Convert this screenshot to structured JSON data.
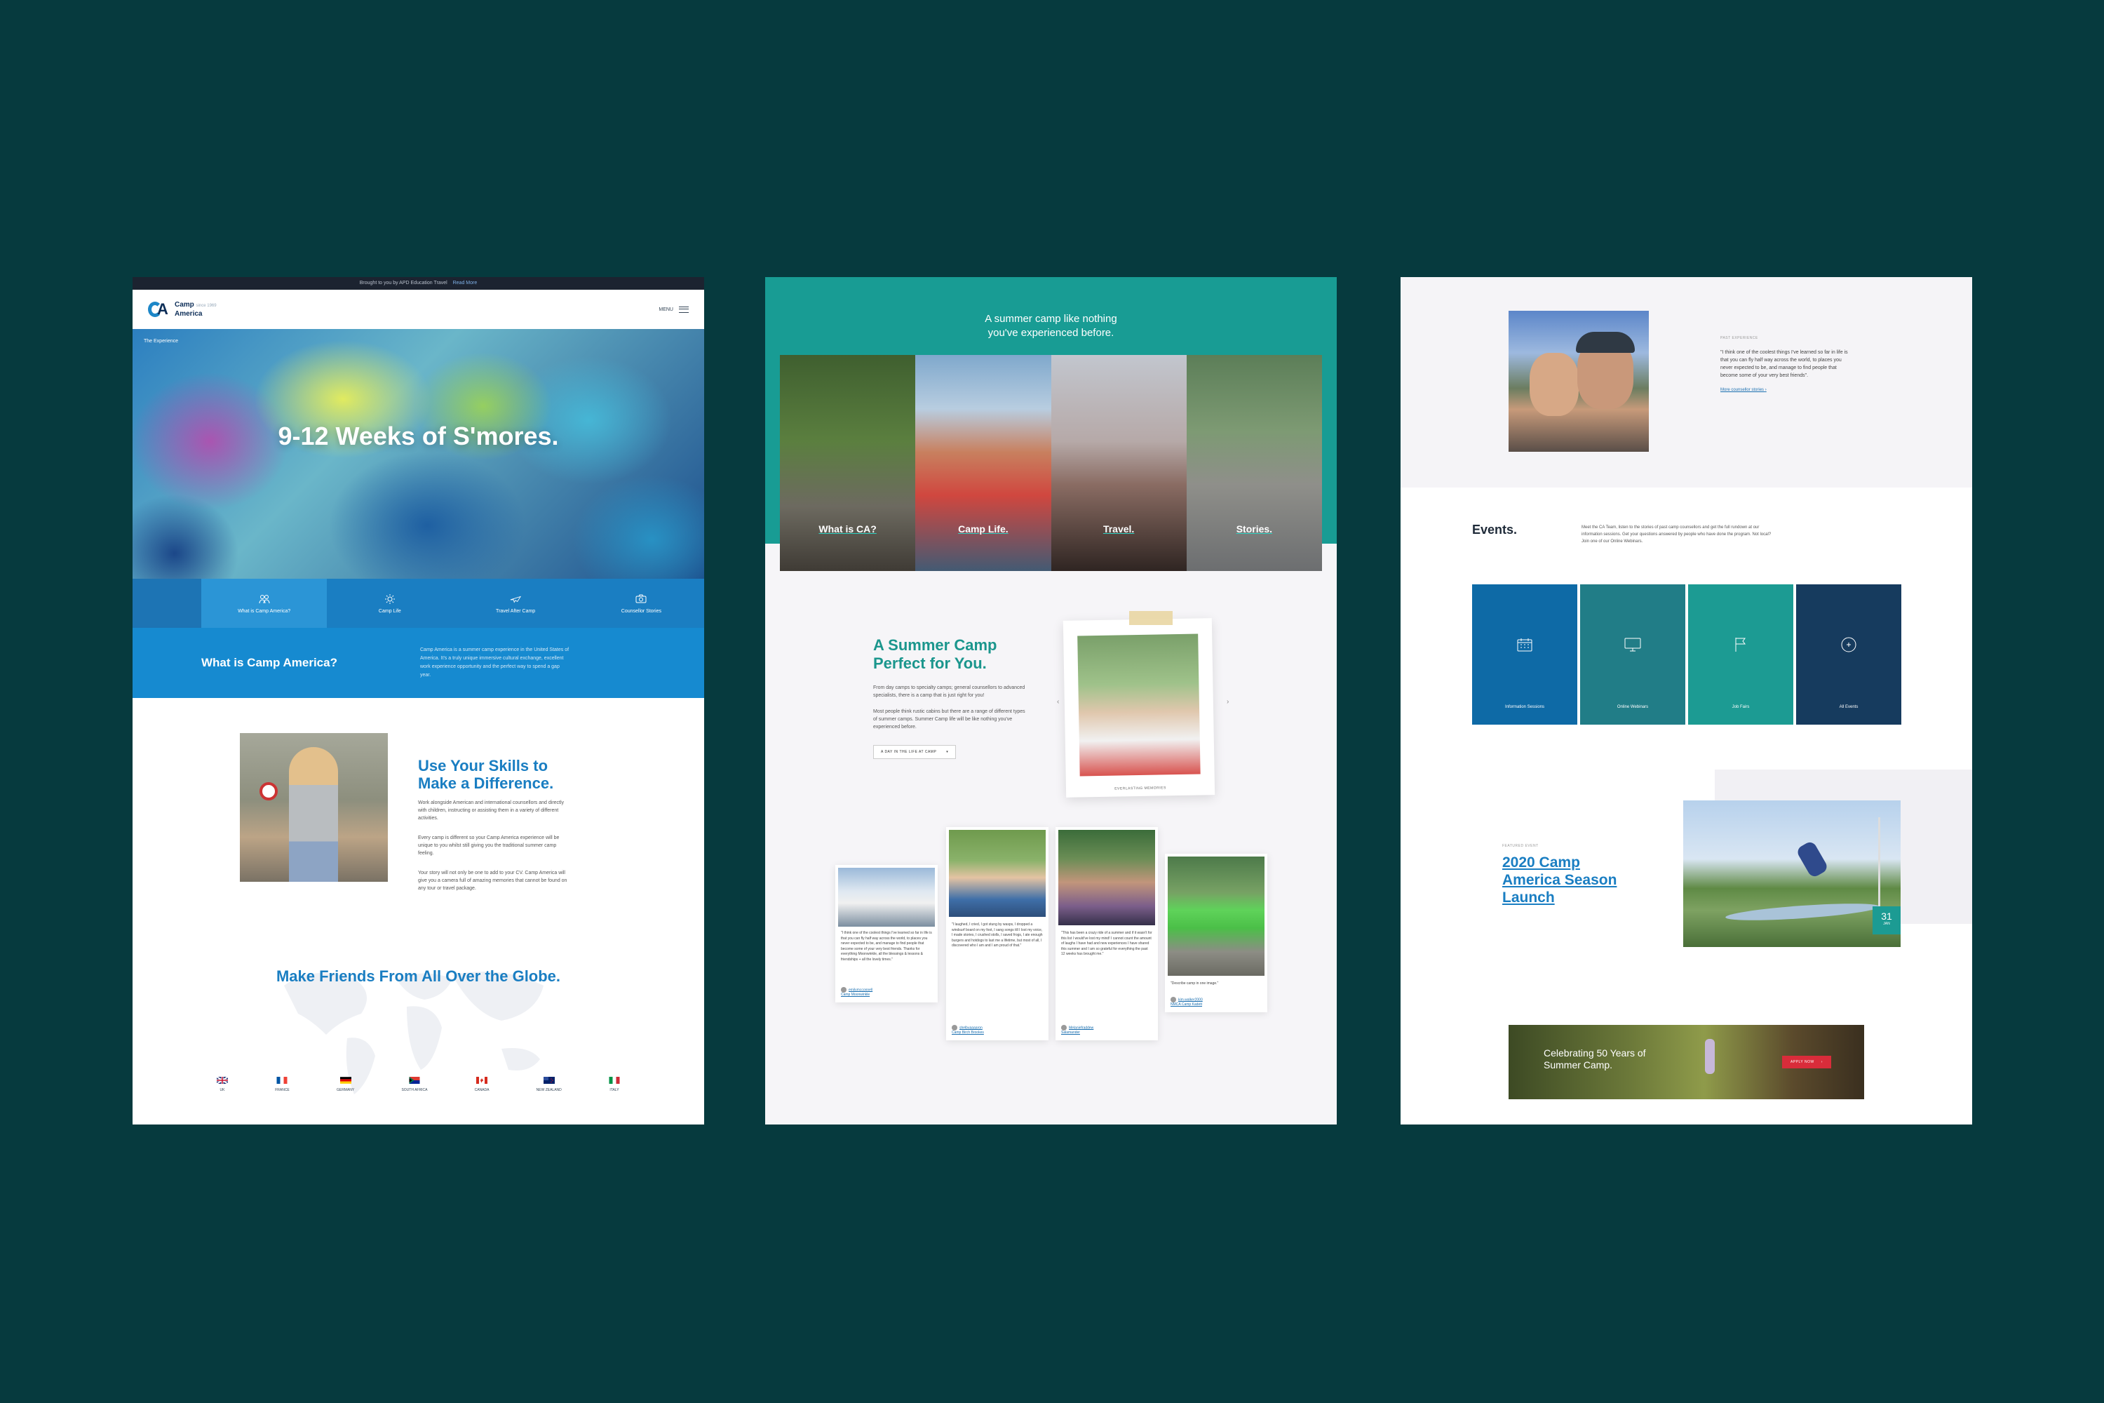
{
  "panel1": {
    "topbar": {
      "text": "Brought to you by APD Education Travel",
      "link": "Read More"
    },
    "logo": {
      "line1": "Camp",
      "line2": "America",
      "small": "since 1969"
    },
    "nav": {
      "menu_label": "MENU"
    },
    "hero": {
      "breadcrumb": "The Experience",
      "title": "9-12 Weeks of S'mores."
    },
    "tabs": [
      {
        "label": "What is Camp America?",
        "icon": "people-icon"
      },
      {
        "label": "Camp Life",
        "icon": "sun-icon"
      },
      {
        "label": "Travel After Camp",
        "icon": "plane-icon"
      },
      {
        "label": "Counsellor Stories",
        "icon": "camera-icon"
      }
    ],
    "what": {
      "title": "What is Camp America?",
      "body": "Camp America is a summer camp experience in the United States of America. It's a truly unique immersive cultural exchange, excellent work experience opportunity and the perfect way to spend a gap year."
    },
    "skills": {
      "title": "Use Your Skills to Make a Difference.",
      "p1": "Work alongside American and international counsellors and directly with children, instructing or assisting them in a variety of different activities.",
      "p2": "Every camp is different so your Camp America experience will be unique to you whilst still giving you the traditional summer camp feeling.",
      "p3": "Your story will not only be one to add to your CV. Camp America will give you a camera full of amazing memories that cannot be found on any tour or travel package."
    },
    "globe": {
      "title": "Make Friends From All Over the Globe.",
      "countries": [
        "UK",
        "FRANCE",
        "GERMANY",
        "SOUTH AFRICA",
        "CANADA",
        "NEW ZEALAND",
        "ITALY"
      ]
    }
  },
  "panel2": {
    "headline": "A summer camp like nothing you've experienced before.",
    "tiles": [
      "What is CA?",
      "Camp Life.",
      "Travel.",
      "Stories."
    ],
    "camp": {
      "title": "A Summer Camp Perfect for You.",
      "p1": "From day camps to specialty camps; general counsellors to advanced specialists, there is a camp that is just right for you!",
      "p2": "Most people think rustic cabins but there are a range of different types of summer camps. Summer Camp life will be like nothing you've experienced before.",
      "button": "A DAY IN THE LIFE AT CAMP"
    },
    "polaroid_caption": "EVERLASTING MEMORIES",
    "cards": [
      {
        "text": "\"I think one of the coolest things I've learned so far in life is that you can fly half way across the world, to places you never expected to be, and manage to find people that become some of your very best friends. Thanks for everything Moonwinkle, all the blessings & lessons & friendships + all the lovely times.\"",
        "user": "emilymcconnell",
        "camp": "Camp Moonwinkle"
      },
      {
        "text": "\"I laughed, I cried, I got stung by wasps, I dropped a windsurf board on my foot, I sang songs till I lost my voice, I made stories, I crushed stolls, I saved frogs, I ate enough burgers and hotdogs to last me a lifetime, but most of all, I discovered who I am and I am proud of that.\"",
        "user": "shelbyaaaaron",
        "camp": "Camp Birch Brookes"
      },
      {
        "text": "\"This has been a crazy ride of a summer and if it wasn't for this list I would've lost my mind! I cannot count the amount of laughs I have had and new experiences I have shared this summer and I am so grateful for everything the past 12 weeks has brought me.\"",
        "user": "Melaniefraddew",
        "camp": "Salamander"
      },
      {
        "text": "\"Describe camp in one image.\"",
        "user": "kim.walker2000",
        "camp": "NMCA Camp Kadett"
      }
    ]
  },
  "panel3": {
    "story": {
      "kicker": "PAST EXPERIENCE",
      "quote": "\"I think one of the coolest things I've learned so far in life is that you can fly half way across the world, to places you never expected to be, and manage to find people that become some of your very best friends\".",
      "more": "More counsellor stories"
    },
    "events": {
      "title": "Events.",
      "body": "Meet the CA Team, listen to the stories of past camp counsellors and get the full rundown at our information sessions. Get your questions answered by people who have done the program. Not local? Join one of our Online Webinars.",
      "tiles": [
        {
          "label": "Information Sessions",
          "icon": "calendar-icon",
          "color": "#0e6aa6"
        },
        {
          "label": "Online Webinars",
          "icon": "monitor-icon",
          "color": "#217d87"
        },
        {
          "label": "Job Fairs",
          "icon": "flag-icon",
          "color": "#1c9b93"
        },
        {
          "label": "All Events",
          "icon": "plus-circle-icon",
          "color": "#163b5e"
        }
      ]
    },
    "featured": {
      "kicker": "FEATURED EVENT",
      "title": "2020 Camp America Season Launch",
      "day": "31",
      "month": "JAN"
    },
    "banner": {
      "title": "Celebrating 50 Years of Summer Camp.",
      "button": "APPLY NOW"
    }
  }
}
